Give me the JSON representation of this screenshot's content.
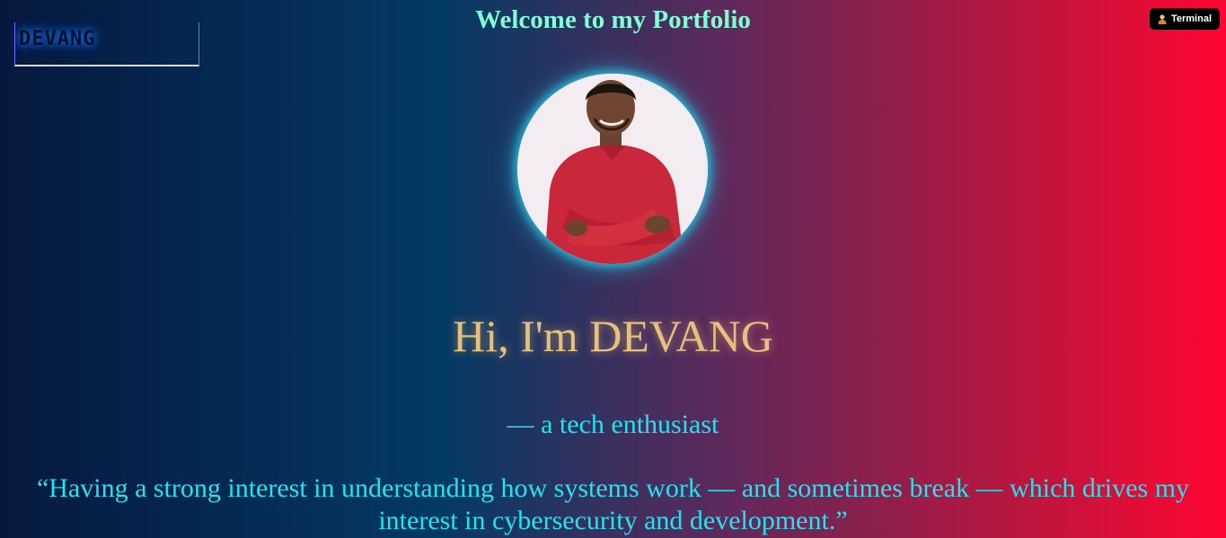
{
  "header": {
    "logo_text": "DEVANG",
    "title": "Welcome to my Portfolio",
    "terminal_button": {
      "label": "Terminal",
      "icon": "user-icon"
    }
  },
  "hero": {
    "profile_image": "profile-photo",
    "greeting": "Hi, I'm DEVANG",
    "tagline": "— a tech enthusiast",
    "quote": "“Having a strong interest in understanding how systems work — and sometimes break — which drives my interest in cybersecurity and development.”"
  },
  "colors": {
    "gradient_left": "#06183e",
    "gradient_mid": "#033a63",
    "gradient_right": "#ff0631",
    "title": "#7fffd4",
    "greeting": "#e6c17e",
    "text_cyan": "#22e4f0"
  }
}
